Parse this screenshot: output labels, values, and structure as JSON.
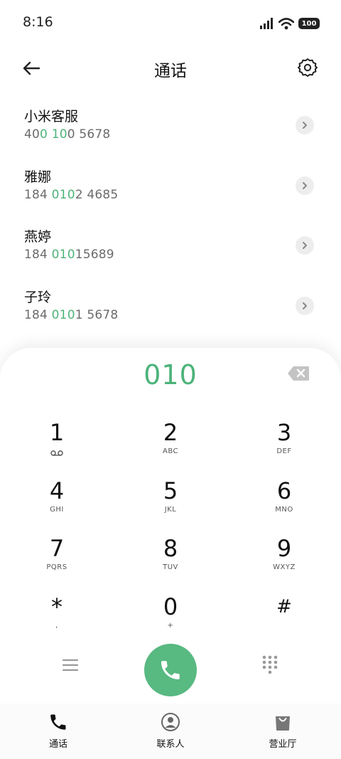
{
  "status_bar": {
    "time": "8:16",
    "battery": "100"
  },
  "header": {
    "title": "通话"
  },
  "contacts": [
    {
      "name": "小米客服",
      "number_parts": [
        {
          "t": "40",
          "hl": false
        },
        {
          "t": "0",
          "hl": true
        },
        {
          "t": " ",
          "hl": false
        },
        {
          "t": "10",
          "hl": true
        },
        {
          "t": "0 5678",
          "hl": false
        }
      ]
    },
    {
      "name": "雅娜",
      "number_parts": [
        {
          "t": "184 ",
          "hl": false
        },
        {
          "t": "010",
          "hl": true
        },
        {
          "t": "2 4685",
          "hl": false
        }
      ]
    },
    {
      "name": "燕婷",
      "number_parts": [
        {
          "t": "184 ",
          "hl": false
        },
        {
          "t": "010",
          "hl": true
        },
        {
          "t": "15689",
          "hl": false
        }
      ]
    },
    {
      "name": "子玲",
      "number_parts": [
        {
          "t": "184 ",
          "hl": false
        },
        {
          "t": "010",
          "hl": true
        },
        {
          "t": "1 5678",
          "hl": false
        }
      ]
    }
  ],
  "dialer": {
    "input": "010",
    "keys": [
      [
        {
          "digit": "1",
          "letters": "",
          "sub": "voicemail"
        },
        {
          "digit": "2",
          "letters": "ABC"
        },
        {
          "digit": "3",
          "letters": "DEF"
        }
      ],
      [
        {
          "digit": "4",
          "letters": "GHI"
        },
        {
          "digit": "5",
          "letters": "JKL"
        },
        {
          "digit": "6",
          "letters": "MNO"
        }
      ],
      [
        {
          "digit": "7",
          "letters": "PQRS"
        },
        {
          "digit": "8",
          "letters": "TUV"
        },
        {
          "digit": "9",
          "letters": "WXYZ"
        }
      ],
      [
        {
          "digit": "*",
          "letters": ","
        },
        {
          "digit": "0",
          "letters": "+"
        },
        {
          "digit": "#",
          "letters": ""
        }
      ]
    ]
  },
  "nav": {
    "calls": "通话",
    "contacts": "联系人",
    "hall": "营业厅"
  },
  "colors": {
    "accent": "#4cb37a",
    "call_button": "#58b981"
  }
}
